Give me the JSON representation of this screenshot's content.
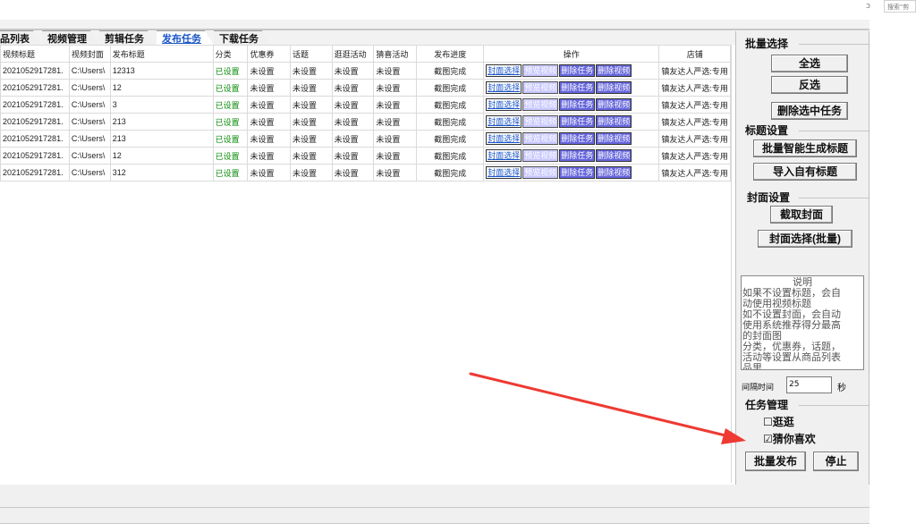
{
  "outer": {
    "window_control": "ɔ",
    "search_placeholder": "搜索\"剪"
  },
  "tabs": [
    {
      "label": "品列表",
      "active": false
    },
    {
      "label": "视频管理",
      "active": false
    },
    {
      "label": "剪辑任务",
      "active": false
    },
    {
      "label": "发布任务",
      "active": true
    },
    {
      "label": "下载任务",
      "active": false
    }
  ],
  "table": {
    "headers": [
      "视频标题",
      "视频封面",
      "发布标题",
      "分类",
      "优惠券",
      "话题",
      "逛逛活动",
      "猜喜活动",
      "发布进度",
      "操作",
      "店铺"
    ],
    "row_buttons": {
      "cover": "封面选择",
      "preview": "预览视频",
      "delete_task": "删除任务",
      "delete_video": "删除视频"
    },
    "rows": [
      {
        "title": "2021052917281.",
        "cover": "C:\\Users\\",
        "publish_title": "12313",
        "category": "已设置",
        "coupon": "未设置",
        "topic": "未设置",
        "stroll": "未设置",
        "guess": "未设置",
        "progress": "截图完成",
        "shop": "镇友达人严选:专用"
      },
      {
        "title": "2021052917281.",
        "cover": "C:\\Users\\",
        "publish_title": "12",
        "category": "已设置",
        "coupon": "未设置",
        "topic": "未设置",
        "stroll": "未设置",
        "guess": "未设置",
        "progress": "截图完成",
        "shop": "镇友达人严选:专用"
      },
      {
        "title": "2021052917281.",
        "cover": "C:\\Users\\",
        "publish_title": "3",
        "category": "已设置",
        "coupon": "未设置",
        "topic": "未设置",
        "stroll": "未设置",
        "guess": "未设置",
        "progress": "截图完成",
        "shop": "镇友达人严选:专用"
      },
      {
        "title": "2021052917281.",
        "cover": "C:\\Users\\",
        "publish_title": "213",
        "category": "已设置",
        "coupon": "未设置",
        "topic": "未设置",
        "stroll": "未设置",
        "guess": "未设置",
        "progress": "截图完成",
        "shop": "镇友达人严选:专用"
      },
      {
        "title": "2021052917281.",
        "cover": "C:\\Users\\",
        "publish_title": "213",
        "category": "已设置",
        "coupon": "未设置",
        "topic": "未设置",
        "stroll": "未设置",
        "guess": "未设置",
        "progress": "截图完成",
        "shop": "镇友达人严选:专用"
      },
      {
        "title": "2021052917281.",
        "cover": "C:\\Users\\",
        "publish_title": "12",
        "category": "已设置",
        "coupon": "未设置",
        "topic": "未设置",
        "stroll": "未设置",
        "guess": "未设置",
        "progress": "截图完成",
        "shop": "镇友达人严选:专用"
      },
      {
        "title": "2021052917281.",
        "cover": "C:\\Users\\",
        "publish_title": "312",
        "category": "已设置",
        "coupon": "未设置",
        "topic": "未设置",
        "stroll": "未设置",
        "guess": "未设置",
        "progress": "截图完成",
        "shop": "镇友达人严选:专用"
      }
    ]
  },
  "panel": {
    "batch_select": {
      "title": "批量选择",
      "select_all": "全选",
      "invert": "反选",
      "delete_selected": "删除选中任务"
    },
    "title_settings": {
      "title": "标题设置",
      "auto_generate": "批量智能生成标题",
      "import_titles": "导入自有标题"
    },
    "cover_settings": {
      "title": "封面设置",
      "capture": "截取封面",
      "batch_select": "封面选择(批量)"
    },
    "notes": {
      "title": "说明",
      "lines": [
        "如果不设置标题，会自",
        "动使用视频标题",
        "如不设置封面，会自动",
        "使用系统推荐得分最高",
        "的封面图",
        "分类，优惠券，话题，",
        "活动等设置从商品列表",
        "品里"
      ]
    },
    "interval": {
      "label": "间隔时间",
      "value": "25",
      "unit": "秒"
    },
    "task_mgmt": {
      "title": "任务管理",
      "stroll": {
        "label": "逛逛",
        "checked": false
      },
      "guess": {
        "label": "猜你喜欢",
        "checked": true
      },
      "batch_publish": "批量发布",
      "stop": "停止"
    }
  },
  "colors": {
    "active_tab": "#1a55c8",
    "set_status": "#0a8a0a",
    "arrow": "#ee3a33"
  }
}
